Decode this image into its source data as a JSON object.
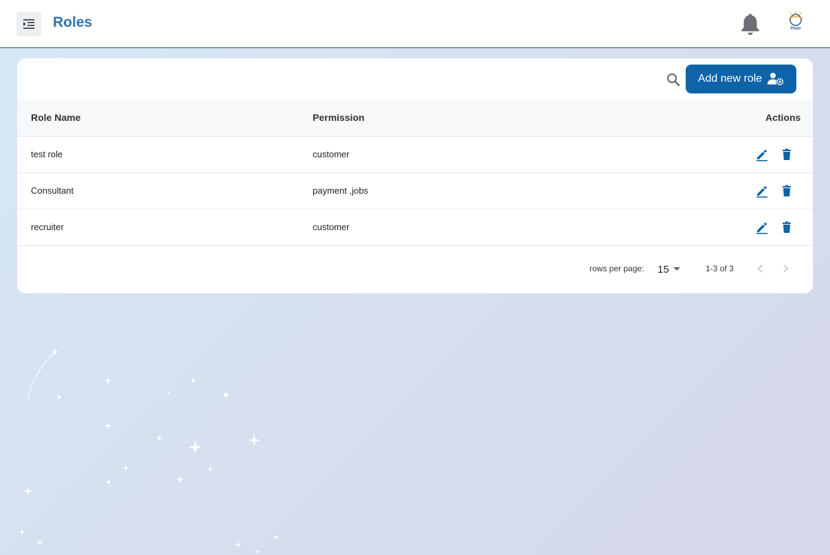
{
  "header": {
    "title": "Roles",
    "avatar_label": "Pluto"
  },
  "toolbar": {
    "add_label": "Add new role"
  },
  "table": {
    "columns": [
      "Role Name",
      "Permission",
      "Actions"
    ],
    "rows": [
      {
        "role": "test role",
        "permission": "customer"
      },
      {
        "role": "Consultant",
        "permission": "payment ,jobs"
      },
      {
        "role": "recruiter",
        "permission": "customer"
      }
    ]
  },
  "pagination": {
    "rows_per_page_label": "rows per page:",
    "rows_per_page_value": "15",
    "range_text": "1-3 of 3"
  },
  "colors": {
    "accent": "#0f63a8",
    "title": "#2c74b3"
  }
}
